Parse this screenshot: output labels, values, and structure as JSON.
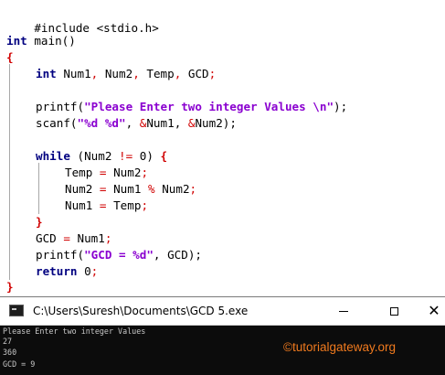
{
  "editor": {
    "include": "#include <stdio.h>",
    "main_kw": "int",
    "main_name": " main()",
    "open_main": "{",
    "decl_kw": "int",
    "decl_vars_1": " Num1",
    "decl_comma_1": ",",
    "decl_vars_2": " Num2",
    "decl_comma_2": ",",
    "decl_vars_3": " Temp",
    "decl_comma_3": ",",
    "decl_vars_4": " GCD",
    "decl_semi": ";",
    "printf1_fn": "printf(",
    "printf1_str": "\"Please Enter two integer Values \\n\"",
    "printf1_end": ");",
    "scanf_fn": "scanf(",
    "scanf_str": "\"%d %d\"",
    "scanf_c1": ", ",
    "scanf_amp1": "&",
    "scanf_a1": "Num1",
    "scanf_c2": ", ",
    "scanf_amp2": "&",
    "scanf_a2": "Num2",
    "scanf_end": ");",
    "while_kw": "while",
    "while_open": " (Num2 ",
    "while_op": "!=",
    "while_num": " 0",
    "while_close": ") ",
    "while_brace": "{",
    "body1_a": "Temp ",
    "body1_op": "=",
    "body1_b": " Num2",
    "body1_semi": ";",
    "body2_a": "Num2 ",
    "body2_op": "=",
    "body2_b": " Num1 ",
    "body2_mod": "%",
    "body2_c": " Num2",
    "body2_semi": ";",
    "body3_a": "Num1 ",
    "body3_op": "=",
    "body3_b": " Temp",
    "body3_semi": ";",
    "close_while": "}",
    "gcd_a": "GCD ",
    "gcd_op": "=",
    "gcd_b": " Num1",
    "gcd_semi": ";",
    "printf2_fn": "printf(",
    "printf2_str": "\"GCD = %d\"",
    "printf2_end": ", GCD);",
    "return_kw": "return",
    "return_val": " 0",
    "return_semi": ";",
    "close_main": "}"
  },
  "console": {
    "title": "C:\\Users\\Suresh\\Documents\\GCD 5.exe",
    "lines": [
      "Please Enter two integer Values",
      "27",
      "360",
      "GCD = 9"
    ],
    "watermark": "©tutorialgateway.org"
  },
  "colors": {
    "keyword": "#000080",
    "string": "#8a00d0",
    "operator": "#d00000",
    "console_bg": "#0c0c0c",
    "console_text": "#c8c8c8",
    "watermark": "#f07a1e"
  },
  "icons": {
    "app": "console-app-icon",
    "minimize": "minimize-icon",
    "maximize": "maximize-icon",
    "close": "close-icon"
  }
}
